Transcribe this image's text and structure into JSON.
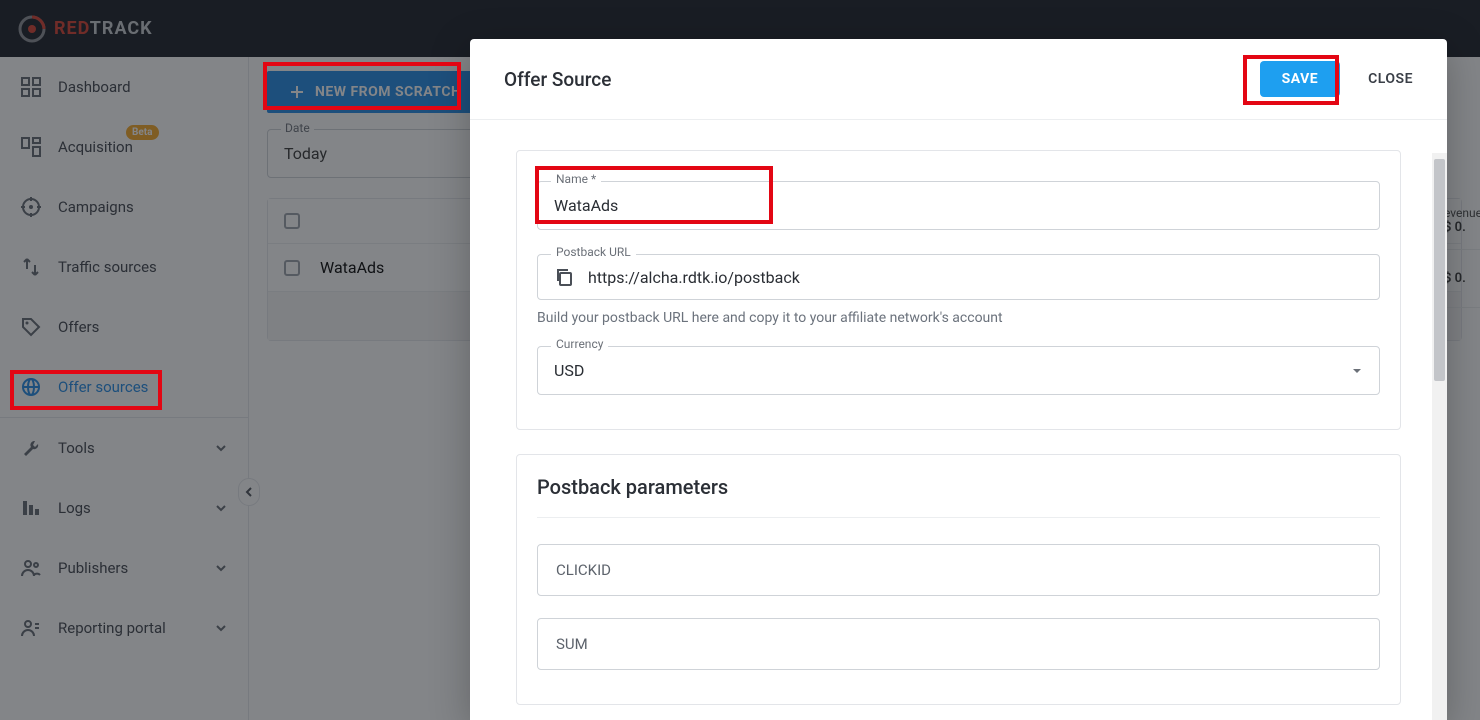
{
  "brand": {
    "red": "RED",
    "track": "TRACK"
  },
  "sidebar": {
    "items": [
      {
        "label": "Dashboard"
      },
      {
        "label": "Acquisition",
        "badge": "Beta"
      },
      {
        "label": "Campaigns"
      },
      {
        "label": "Traffic sources"
      },
      {
        "label": "Offers"
      },
      {
        "label": "Offer sources"
      },
      {
        "label": "Tools"
      },
      {
        "label": "Logs"
      },
      {
        "label": "Publishers"
      },
      {
        "label": "Reporting portal"
      }
    ]
  },
  "main": {
    "new_button": "NEW FROM SCRATCH",
    "date_label": "Date",
    "date_value": "Today",
    "rows": [
      {
        "name": "WataAds"
      }
    ]
  },
  "revenue": {
    "header": "evenue",
    "values": [
      "$ 0.",
      "$ 0."
    ]
  },
  "modal": {
    "title": "Offer Source",
    "save": "SAVE",
    "close": "CLOSE",
    "name_label": "Name *",
    "name_value": "WataAds",
    "postback_label": "Postback URL",
    "postback_value": "https://alcha.rdtk.io/postback",
    "postback_hint": "Build your postback URL here and copy it to your affiliate network's account",
    "currency_label": "Currency",
    "currency_value": "USD",
    "params_title": "Postback parameters",
    "params": [
      "CLICKID",
      "SUM"
    ]
  }
}
